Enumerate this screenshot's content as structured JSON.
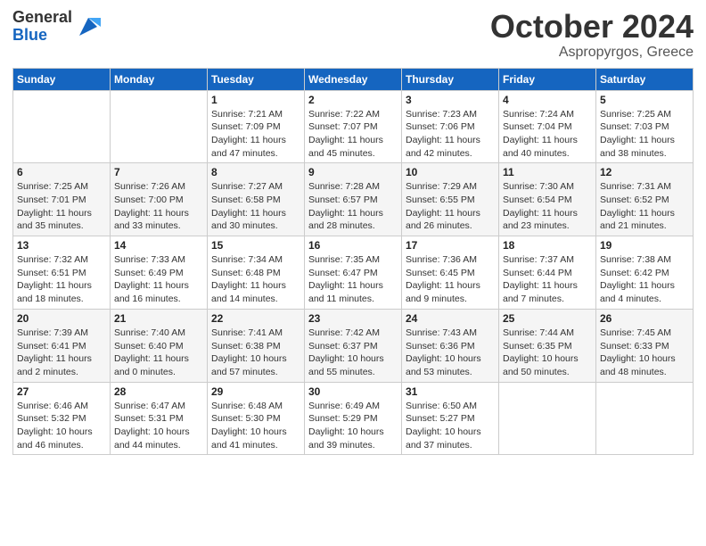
{
  "header": {
    "logo_general": "General",
    "logo_blue": "Blue",
    "month_title": "October 2024",
    "location": "Aspropyrgos, Greece"
  },
  "days_of_week": [
    "Sunday",
    "Monday",
    "Tuesday",
    "Wednesday",
    "Thursday",
    "Friday",
    "Saturday"
  ],
  "weeks": [
    [
      {
        "num": "",
        "sunrise": "",
        "sunset": "",
        "daylight": ""
      },
      {
        "num": "",
        "sunrise": "",
        "sunset": "",
        "daylight": ""
      },
      {
        "num": "1",
        "sunrise": "Sunrise: 7:21 AM",
        "sunset": "Sunset: 7:09 PM",
        "daylight": "Daylight: 11 hours and 47 minutes."
      },
      {
        "num": "2",
        "sunrise": "Sunrise: 7:22 AM",
        "sunset": "Sunset: 7:07 PM",
        "daylight": "Daylight: 11 hours and 45 minutes."
      },
      {
        "num": "3",
        "sunrise": "Sunrise: 7:23 AM",
        "sunset": "Sunset: 7:06 PM",
        "daylight": "Daylight: 11 hours and 42 minutes."
      },
      {
        "num": "4",
        "sunrise": "Sunrise: 7:24 AM",
        "sunset": "Sunset: 7:04 PM",
        "daylight": "Daylight: 11 hours and 40 minutes."
      },
      {
        "num": "5",
        "sunrise": "Sunrise: 7:25 AM",
        "sunset": "Sunset: 7:03 PM",
        "daylight": "Daylight: 11 hours and 38 minutes."
      }
    ],
    [
      {
        "num": "6",
        "sunrise": "Sunrise: 7:25 AM",
        "sunset": "Sunset: 7:01 PM",
        "daylight": "Daylight: 11 hours and 35 minutes."
      },
      {
        "num": "7",
        "sunrise": "Sunrise: 7:26 AM",
        "sunset": "Sunset: 7:00 PM",
        "daylight": "Daylight: 11 hours and 33 minutes."
      },
      {
        "num": "8",
        "sunrise": "Sunrise: 7:27 AM",
        "sunset": "Sunset: 6:58 PM",
        "daylight": "Daylight: 11 hours and 30 minutes."
      },
      {
        "num": "9",
        "sunrise": "Sunrise: 7:28 AM",
        "sunset": "Sunset: 6:57 PM",
        "daylight": "Daylight: 11 hours and 28 minutes."
      },
      {
        "num": "10",
        "sunrise": "Sunrise: 7:29 AM",
        "sunset": "Sunset: 6:55 PM",
        "daylight": "Daylight: 11 hours and 26 minutes."
      },
      {
        "num": "11",
        "sunrise": "Sunrise: 7:30 AM",
        "sunset": "Sunset: 6:54 PM",
        "daylight": "Daylight: 11 hours and 23 minutes."
      },
      {
        "num": "12",
        "sunrise": "Sunrise: 7:31 AM",
        "sunset": "Sunset: 6:52 PM",
        "daylight": "Daylight: 11 hours and 21 minutes."
      }
    ],
    [
      {
        "num": "13",
        "sunrise": "Sunrise: 7:32 AM",
        "sunset": "Sunset: 6:51 PM",
        "daylight": "Daylight: 11 hours and 18 minutes."
      },
      {
        "num": "14",
        "sunrise": "Sunrise: 7:33 AM",
        "sunset": "Sunset: 6:49 PM",
        "daylight": "Daylight: 11 hours and 16 minutes."
      },
      {
        "num": "15",
        "sunrise": "Sunrise: 7:34 AM",
        "sunset": "Sunset: 6:48 PM",
        "daylight": "Daylight: 11 hours and 14 minutes."
      },
      {
        "num": "16",
        "sunrise": "Sunrise: 7:35 AM",
        "sunset": "Sunset: 6:47 PM",
        "daylight": "Daylight: 11 hours and 11 minutes."
      },
      {
        "num": "17",
        "sunrise": "Sunrise: 7:36 AM",
        "sunset": "Sunset: 6:45 PM",
        "daylight": "Daylight: 11 hours and 9 minutes."
      },
      {
        "num": "18",
        "sunrise": "Sunrise: 7:37 AM",
        "sunset": "Sunset: 6:44 PM",
        "daylight": "Daylight: 11 hours and 7 minutes."
      },
      {
        "num": "19",
        "sunrise": "Sunrise: 7:38 AM",
        "sunset": "Sunset: 6:42 PM",
        "daylight": "Daylight: 11 hours and 4 minutes."
      }
    ],
    [
      {
        "num": "20",
        "sunrise": "Sunrise: 7:39 AM",
        "sunset": "Sunset: 6:41 PM",
        "daylight": "Daylight: 11 hours and 2 minutes."
      },
      {
        "num": "21",
        "sunrise": "Sunrise: 7:40 AM",
        "sunset": "Sunset: 6:40 PM",
        "daylight": "Daylight: 11 hours and 0 minutes."
      },
      {
        "num": "22",
        "sunrise": "Sunrise: 7:41 AM",
        "sunset": "Sunset: 6:38 PM",
        "daylight": "Daylight: 10 hours and 57 minutes."
      },
      {
        "num": "23",
        "sunrise": "Sunrise: 7:42 AM",
        "sunset": "Sunset: 6:37 PM",
        "daylight": "Daylight: 10 hours and 55 minutes."
      },
      {
        "num": "24",
        "sunrise": "Sunrise: 7:43 AM",
        "sunset": "Sunset: 6:36 PM",
        "daylight": "Daylight: 10 hours and 53 minutes."
      },
      {
        "num": "25",
        "sunrise": "Sunrise: 7:44 AM",
        "sunset": "Sunset: 6:35 PM",
        "daylight": "Daylight: 10 hours and 50 minutes."
      },
      {
        "num": "26",
        "sunrise": "Sunrise: 7:45 AM",
        "sunset": "Sunset: 6:33 PM",
        "daylight": "Daylight: 10 hours and 48 minutes."
      }
    ],
    [
      {
        "num": "27",
        "sunrise": "Sunrise: 6:46 AM",
        "sunset": "Sunset: 5:32 PM",
        "daylight": "Daylight: 10 hours and 46 minutes."
      },
      {
        "num": "28",
        "sunrise": "Sunrise: 6:47 AM",
        "sunset": "Sunset: 5:31 PM",
        "daylight": "Daylight: 10 hours and 44 minutes."
      },
      {
        "num": "29",
        "sunrise": "Sunrise: 6:48 AM",
        "sunset": "Sunset: 5:30 PM",
        "daylight": "Daylight: 10 hours and 41 minutes."
      },
      {
        "num": "30",
        "sunrise": "Sunrise: 6:49 AM",
        "sunset": "Sunset: 5:29 PM",
        "daylight": "Daylight: 10 hours and 39 minutes."
      },
      {
        "num": "31",
        "sunrise": "Sunrise: 6:50 AM",
        "sunset": "Sunset: 5:27 PM",
        "daylight": "Daylight: 10 hours and 37 minutes."
      },
      {
        "num": "",
        "sunrise": "",
        "sunset": "",
        "daylight": ""
      },
      {
        "num": "",
        "sunrise": "",
        "sunset": "",
        "daylight": ""
      }
    ]
  ]
}
